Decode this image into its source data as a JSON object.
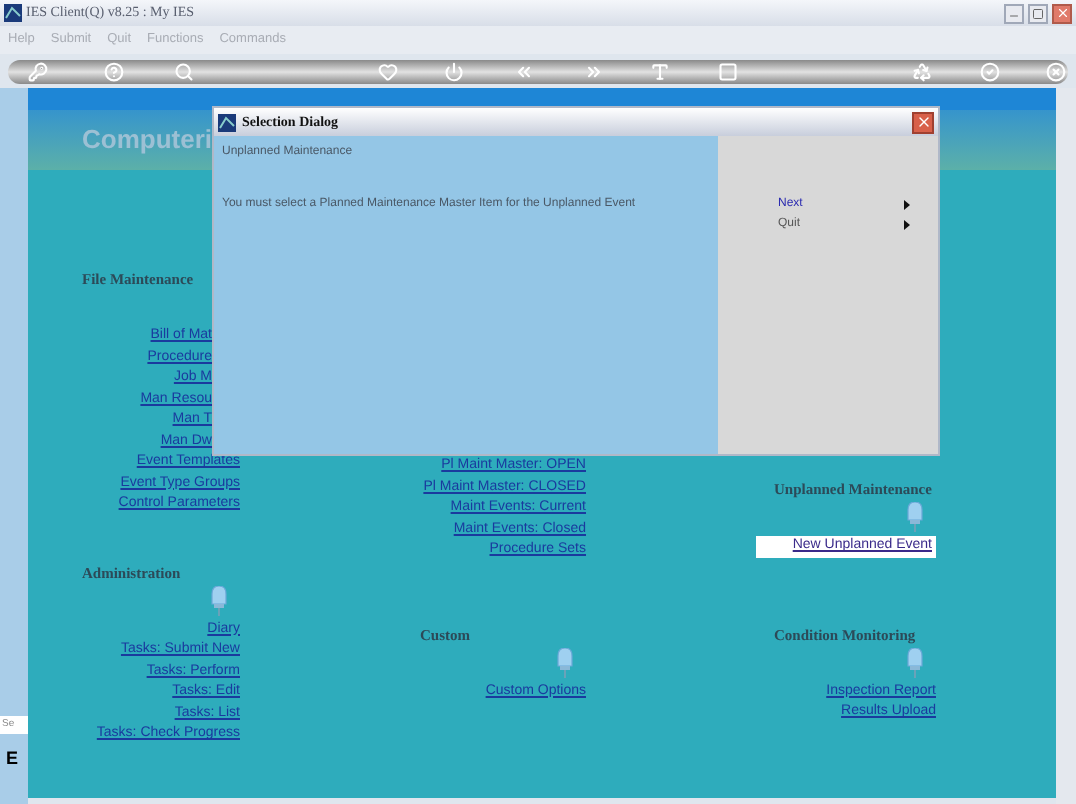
{
  "window": {
    "title": "IES Client(Q) v8.25 : My IES"
  },
  "menu": [
    {
      "label": "Help",
      "disabled": true
    },
    {
      "label": "Submit",
      "disabled": true
    },
    {
      "label": "Quit",
      "disabled": true
    },
    {
      "label": "Functions",
      "disabled": true
    },
    {
      "label": "Commands",
      "disabled": true
    }
  ],
  "banner": {
    "title": "Computeri"
  },
  "side_strip": {
    "field": "Se",
    "letter": "E"
  },
  "columns": [
    {
      "sections": [
        {
          "heading": "File Maintenance",
          "lamp": false,
          "partly_hidden_links": [
            "Bill of Mat",
            "Procedure",
            "Job M",
            "Man Resou",
            "Man T",
            "Man Dw"
          ],
          "links": [
            {
              "label": "Event Templates",
              "highlighted": false
            },
            {
              "label": "Event Type Groups",
              "highlighted": false
            },
            {
              "label": "Control Parameters",
              "highlighted": false
            }
          ]
        },
        {
          "heading": "Administration",
          "lamp": true,
          "links": [
            {
              "label": "Diary",
              "highlighted": false
            },
            {
              "label": "Tasks: Submit New",
              "highlighted": false
            },
            {
              "label": "Tasks: Perform",
              "highlighted": false
            },
            {
              "label": "Tasks: Edit",
              "highlighted": false
            },
            {
              "label": "Tasks: List",
              "highlighted": false
            },
            {
              "label": "Tasks: Check Progress",
              "highlighted": false
            }
          ]
        }
      ]
    },
    {
      "sections": [
        {
          "links": [
            {
              "label": "Pl Maint Master: OPEN",
              "highlighted": false
            },
            {
              "label": "Pl Maint Master: CLOSED",
              "highlighted": false
            },
            {
              "label": "Maint Events: Current",
              "highlighted": false
            },
            {
              "label": "Maint Events: Closed",
              "highlighted": false
            },
            {
              "label": "Procedure Sets",
              "highlighted": false
            }
          ]
        },
        {
          "heading": "Custom",
          "lamp": true,
          "links": [
            {
              "label": "Custom Options",
              "highlighted": false
            }
          ]
        }
      ]
    },
    {
      "sections": [
        {
          "heading": "Unplanned Maintenance",
          "lamp": true,
          "links": [
            {
              "label": "New Unplanned Event",
              "highlighted": true
            }
          ]
        },
        {
          "heading": "Condition Monitoring",
          "lamp": true,
          "links": [
            {
              "label": "Inspection Report",
              "highlighted": false
            },
            {
              "label": "Results Upload",
              "highlighted": false
            }
          ]
        }
      ]
    }
  ],
  "dialog": {
    "title": "Selection Dialog",
    "heading": "Unplanned Maintenance",
    "message": "You must select a Planned Maintenance Master Item for the Unplanned Event",
    "options": [
      {
        "label": "Next",
        "selected": true
      },
      {
        "label": "Quit",
        "selected": false
      }
    ]
  }
}
